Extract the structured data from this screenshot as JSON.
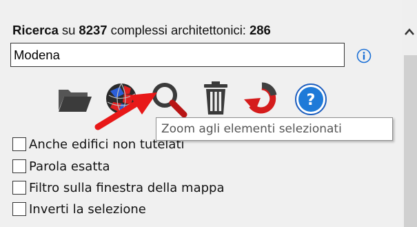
{
  "header": {
    "ricerca": "Ricerca",
    "su": "su",
    "count": "8237",
    "complessi": "complessi architettonici:",
    "result": "286"
  },
  "search": {
    "value": "Modena"
  },
  "icons": {
    "info": "info-icon",
    "folder": "folder-icon",
    "globe": "globe-icon",
    "magnify": "magnify-icon",
    "trash": "trash-icon",
    "undo": "undo-icon",
    "help": "help-icon",
    "arrow": "red-arrow-annotation"
  },
  "tooltip": "Zoom agli elementi selezionati",
  "options": [
    {
      "label": "Anche edifici non tutelati",
      "checked": false
    },
    {
      "label": "Parola esatta",
      "checked": false
    },
    {
      "label": "Filtro sulla finestra della mappa",
      "checked": false
    },
    {
      "label": "Inverti la selezione",
      "checked": false
    }
  ],
  "colors": {
    "accent_red": "#e81818",
    "info_blue": "#1a6fd6",
    "help_blue": "#1e7ad8"
  }
}
